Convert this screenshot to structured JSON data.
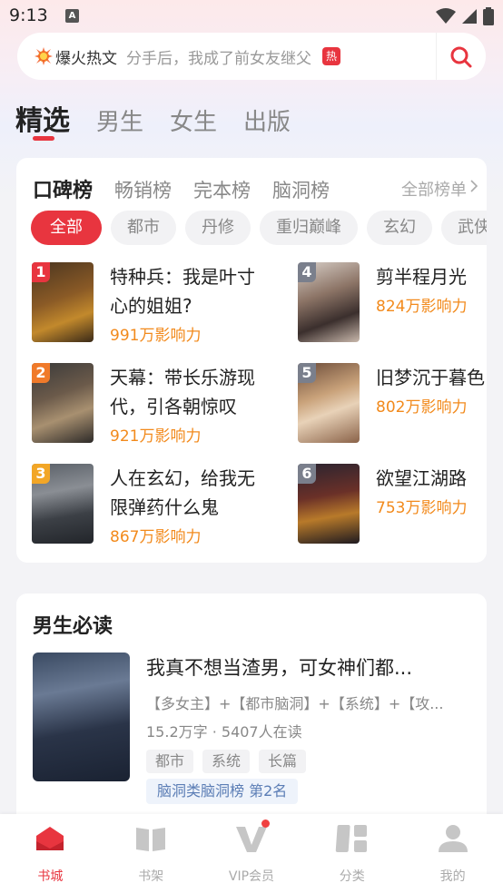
{
  "status_bar": {
    "time": "9:13",
    "notification": "A"
  },
  "search": {
    "hot_label": "爆火热文",
    "placeholder_text": "分手后，我成了前女友继父",
    "hot_badge": "热"
  },
  "main_tabs": [
    "精选",
    "男生",
    "女生",
    "出版"
  ],
  "rank_tabs": [
    "口碑榜",
    "畅销榜",
    "完本榜",
    "脑洞榜"
  ],
  "all_ranks_label": "全部榜单",
  "chips": [
    "全部",
    "都市",
    "丹修",
    "重归巅峰",
    "玄幻",
    "武侠"
  ],
  "rank_books": [
    {
      "rank": "1",
      "title": "特种兵：我是叶寸心的姐姐?",
      "influence": "991万影响力",
      "badge_color": "#e8353f"
    },
    {
      "rank": "2",
      "title": "天幕：带长乐游现代，引各朝惊叹",
      "influence": "921万影响力",
      "badge_color": "#f07a2a"
    },
    {
      "rank": "3",
      "title": "人在玄幻，给我无限弹药什么鬼",
      "influence": "867万影响力",
      "badge_color": "#f2a626"
    },
    {
      "rank": "4",
      "title": "剪半程月光",
      "influence": "824万影响力",
      "badge_color": "#7a7f8c"
    },
    {
      "rank": "5",
      "title": "旧梦沉于暮色",
      "influence": "802万影响力",
      "badge_color": "#7a7f8c"
    },
    {
      "rank": "6",
      "title": "欲望江湖路",
      "influence": "753万影响力",
      "badge_color": "#7a7f8c"
    }
  ],
  "male_section": {
    "title": "男生必读",
    "book_title": "我真不想当渣男，可女神们都...",
    "tags": "【多女主】+【都市脑洞】+【系统】+【攻...",
    "meta": "15.2万字 · 5407人在读",
    "chips": [
      "都市",
      "系统",
      "长篇"
    ],
    "rank_label": "脑洞类脑洞榜  第2名"
  },
  "bottom_nav": [
    {
      "label": "书城",
      "icon": "bookstore-icon"
    },
    {
      "label": "书架",
      "icon": "bookshelf-icon"
    },
    {
      "label": "VIP会员",
      "icon": "vip-icon"
    },
    {
      "label": "分类",
      "icon": "category-icon"
    },
    {
      "label": "我的",
      "icon": "profile-icon"
    }
  ],
  "colors": {
    "accent": "#e8353f",
    "influence": "#f28a1c"
  }
}
